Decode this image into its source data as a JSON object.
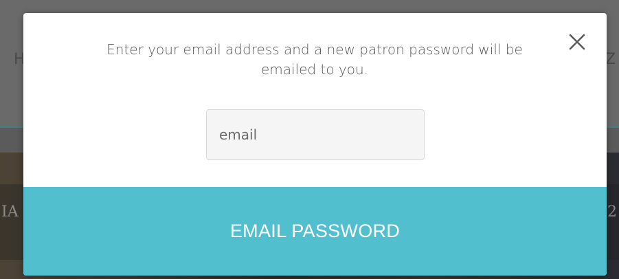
{
  "modal": {
    "message": "Enter your email address and a new patron password will be emailed to you.",
    "email_placeholder": "email",
    "email_value": "",
    "submit_label": "EMAIL PASSWORD",
    "close_icon": "close-icon"
  },
  "background": {
    "partial_left_char": "H",
    "partial_right_char": "Z",
    "strip_left_text": "IA",
    "strip_right_text": "2"
  },
  "colors": {
    "accent": "#52bfcf",
    "backdrop": "#5b5b5b",
    "text": "#585858",
    "input_bg": "#f5f5f5"
  }
}
